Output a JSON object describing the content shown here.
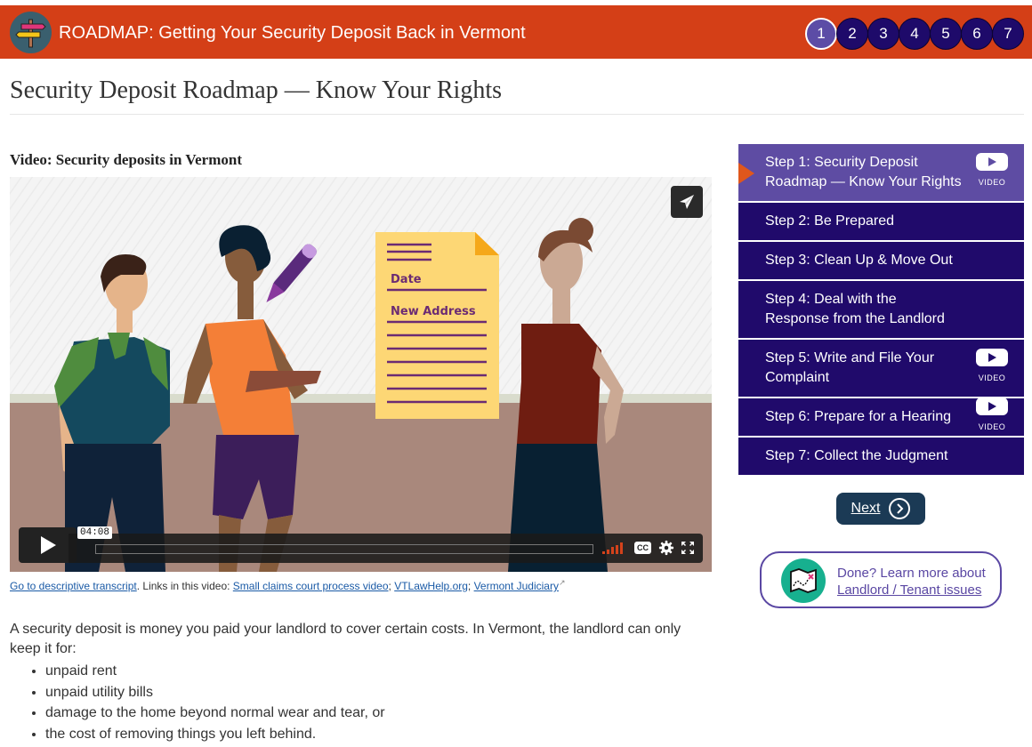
{
  "header": {
    "title": "ROADMAP: Getting Your Security Deposit Back in Vermont",
    "logo_icon": "signpost-icon",
    "step_numbers": [
      "1",
      "2",
      "3",
      "4",
      "5",
      "6",
      "7"
    ],
    "active_step": 1
  },
  "page": {
    "title": "Security Deposit Roadmap — Know Your Rights"
  },
  "video": {
    "heading": "Video: Security deposits in Vermont",
    "time_display": "04:08",
    "cc_label": "CC",
    "scene_text": {
      "date_label": "Date",
      "address_label": "New Address"
    },
    "colors": {
      "volume": "#d4421b"
    }
  },
  "video_links": {
    "transcript_link": "Go to descriptive transcript",
    "separator_text": ". Links in this video: ",
    "links": [
      "Small claims court process video",
      "VTLawHelp.org",
      "Vermont Judiciary"
    ],
    "link_separator": "; "
  },
  "body": {
    "intro": "A security deposit is money you paid your landlord to cover certain costs. In Vermont, the landlord can only keep it for:",
    "bullets": [
      "unpaid rent",
      "unpaid utility bills",
      "damage to the home beyond normal wear and tear, or",
      "the cost of removing things you left behind."
    ]
  },
  "sidebar": {
    "steps": [
      {
        "label": "Step 1: Security Deposit Roadmap — Know Your Rights",
        "has_video": true,
        "active": true
      },
      {
        "label": "Step 2: Be Prepared",
        "has_video": false,
        "active": false
      },
      {
        "label": "Step 3: Clean Up & Move Out",
        "has_video": false,
        "active": false
      },
      {
        "label": "Step 4: Deal with the Response from the Landlord",
        "has_video": false,
        "active": false
      },
      {
        "label": "Step 5: Write and File Your Complaint",
        "has_video": true,
        "active": false
      },
      {
        "label": "Step 6: Prepare for a Hearing",
        "has_video": true,
        "active": false
      },
      {
        "label": "Step 7: Collect the Judgment",
        "has_video": false,
        "active": false
      }
    ],
    "video_badge_label": "VIDEO",
    "next_label": "Next",
    "done_card": {
      "line1": "Done? Learn more about",
      "link": "Landlord / Tenant issues"
    }
  },
  "colors": {
    "header_bg": "#d43f17",
    "step_bg": "#200a6b",
    "step_active_bg": "#5e4ca3",
    "next_bg": "#1b3a55",
    "accent_purple": "#5a47a3"
  }
}
